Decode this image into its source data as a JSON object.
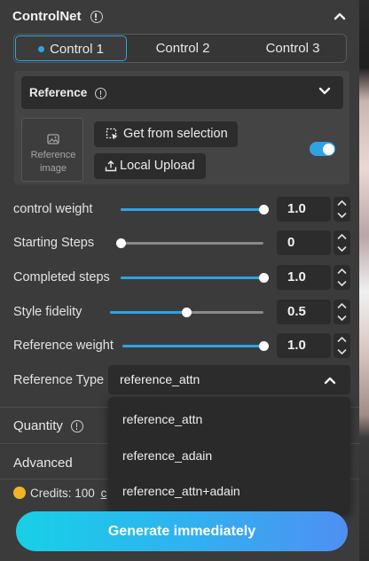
{
  "panel": {
    "title": "ControlNet"
  },
  "tabs": [
    {
      "label": "Control 1",
      "active": true
    },
    {
      "label": "Control 2",
      "active": false
    },
    {
      "label": "Control 3",
      "active": false
    }
  ],
  "reference": {
    "header": "Reference",
    "image_label": "Reference image",
    "get_from_selection": "Get from selection",
    "local_upload": "Local Upload",
    "enabled": true
  },
  "sliders": [
    {
      "label": "control weight",
      "value": "1.0",
      "fraction": 1.0
    },
    {
      "label": "Starting Steps",
      "value": "0",
      "fraction": 0.0
    },
    {
      "label": "Completed steps",
      "value": "1.0",
      "fraction": 1.0
    },
    {
      "label": "Style fidelity",
      "value": "0.5",
      "fraction": 0.5
    },
    {
      "label": "Reference weight",
      "value": "1.0",
      "fraction": 1.0
    }
  ],
  "reference_type": {
    "label": "Reference Type",
    "selected": "reference_attn",
    "options": [
      "reference_attn",
      "reference_adain",
      "reference_attn+adain"
    ]
  },
  "sections": {
    "quantity": "Quantity",
    "advanced": "Advanced"
  },
  "credits": {
    "label": "Credits: 100",
    "partial": "c"
  },
  "generate": {
    "label": "Generate immediately"
  },
  "colors": {
    "accent": "#2ea3e3",
    "coin": "#f0b429",
    "button_start": "#18d0e6",
    "button_end": "#4f8ff2"
  },
  "icons": {
    "info": "info-circle-icon",
    "chevron_up": "chevron-up-icon",
    "chevron_down": "chevron-down-icon",
    "image": "image-icon",
    "selection": "selection-icon",
    "upload": "upload-icon"
  }
}
